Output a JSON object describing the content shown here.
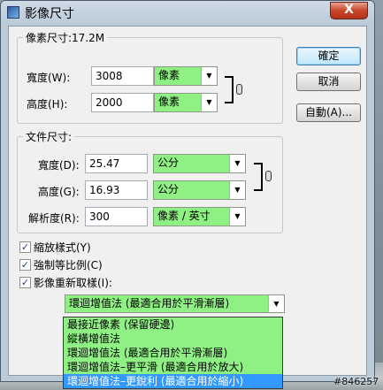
{
  "window": {
    "title": "影像尺寸",
    "close_label": "X"
  },
  "pixel_dimensions": {
    "label": "像素尺寸:17.2M",
    "width_label": "寬度(W):",
    "width_value": "3008",
    "width_unit": "像素",
    "height_label": "高度(H):",
    "height_value": "2000",
    "height_unit": "像素"
  },
  "document_size": {
    "label": "文件尺寸:",
    "width_label": "寬度(D):",
    "width_value": "25.47",
    "width_unit": "公分",
    "height_label": "高度(G):",
    "height_value": "16.93",
    "height_unit": "公分",
    "resolution_label": "解析度(R):",
    "resolution_value": "300",
    "resolution_unit": "像素 / 英寸"
  },
  "buttons": {
    "ok": "確定",
    "cancel": "取消",
    "auto": "自動(A)..."
  },
  "options": {
    "scale_styles": {
      "label": "縮放樣式(Y)",
      "checked": true
    },
    "constrain": {
      "label": "強制等比例(C)",
      "checked": true
    },
    "resample": {
      "label": "影像重新取樣(I):",
      "checked": true
    }
  },
  "resample_select": {
    "value": "環迴增值法 (最適合用於平滑漸層)",
    "options": [
      "最接近像素 (保留硬邊)",
      "縱橫增值法",
      "環迴增值法 (最適合用於平滑漸層)",
      "環迴增值法–更平滑 (最適合用於放大)",
      "環迴增值法–更銳利 (最適合用於縮小)"
    ],
    "highlighted_index": 4
  },
  "watermark": "#846257",
  "colors": {
    "highlight_field": "#8ff083",
    "selection": "#3399ff"
  }
}
